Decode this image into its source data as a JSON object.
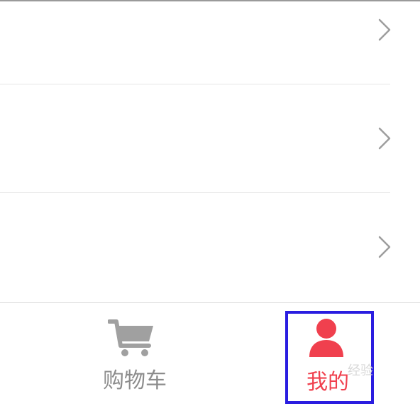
{
  "tabbar": {
    "tabs": [
      {
        "label": "购物车",
        "icon": "cart-icon",
        "active": false
      },
      {
        "label": "我的",
        "icon": "user-icon",
        "active": true
      }
    ]
  },
  "colors": {
    "active": "#f0404e",
    "inactive": "#8c8c8c",
    "highlight_border": "#2a1de0",
    "chevron": "#9e9e9e"
  },
  "watermark": "经验"
}
